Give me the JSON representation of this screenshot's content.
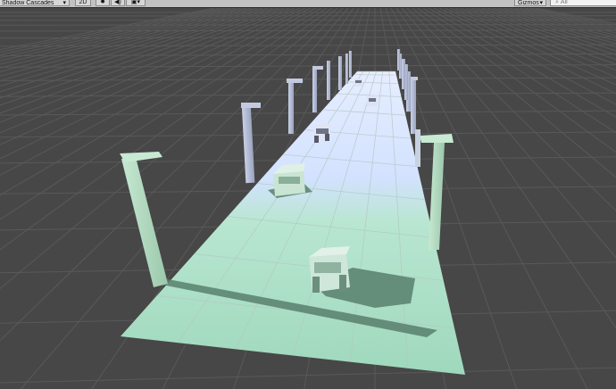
{
  "toolbar": {
    "shading_mode": "Shadow Cascades",
    "mode_2d": "2D",
    "lighting_icon": "sun-icon",
    "audio_icon": "speaker-icon",
    "effects_icon": "image-icon",
    "gizmos_label": "Gizmos",
    "gizmos_icon": "dropdown-arrow-icon",
    "search_placeholder": "All",
    "search_icon": "search-icon"
  },
  "scene": {
    "background_color": "#474747",
    "grid_color": "#5a5a5a",
    "road_color_near": "#a3d9c0",
    "road_color_far": "#d8e6ff",
    "pole_color_near": "#a8d3b7",
    "pole_color_far": "#adb6cf",
    "shadow_color": "#4a6d5d"
  }
}
